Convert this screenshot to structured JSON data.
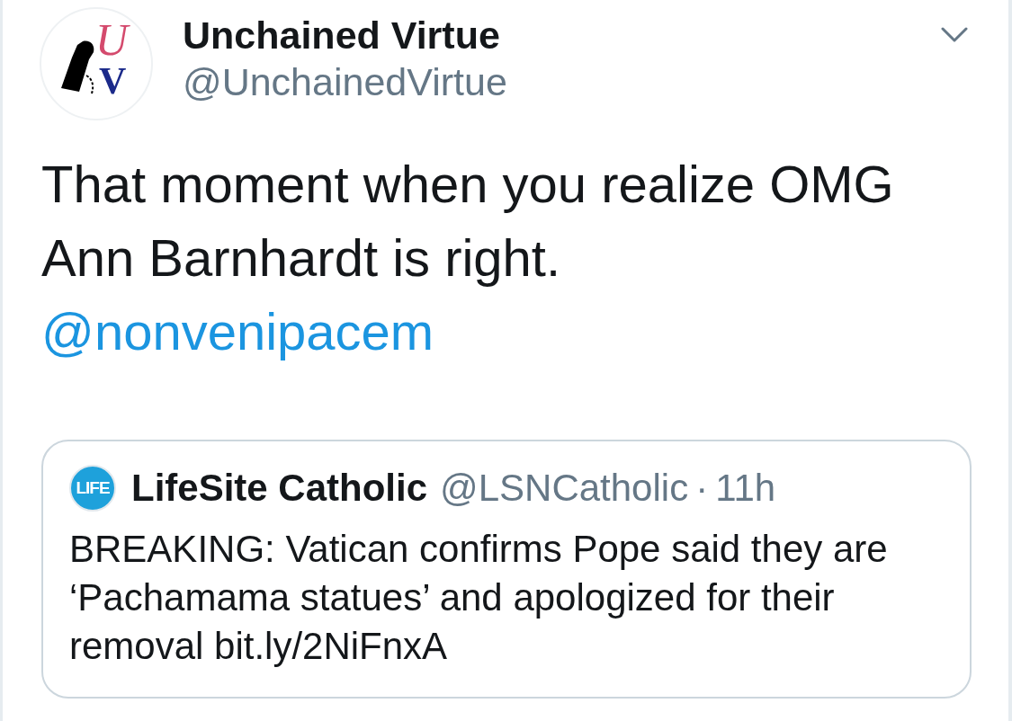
{
  "author": {
    "avatar": {
      "letters": [
        "U",
        "V"
      ]
    },
    "name": "Unchained Virtue",
    "handle": "@UnchainedVirtue"
  },
  "tweet": {
    "text": "That moment when you realize OMG Ann Barnhardt is right.",
    "mention": "@nonvenipacem"
  },
  "quoted_tweet": {
    "avatar": {
      "label": "LIFE"
    },
    "name": "LifeSite Catholic",
    "handle": "@LSNCatholic",
    "separator": "·",
    "time": "11h",
    "text": "BREAKING: Vatican confirms Pope said they are ‘Pachamama statues’ and apologized for their removal bit.ly/2NiFnxA"
  }
}
